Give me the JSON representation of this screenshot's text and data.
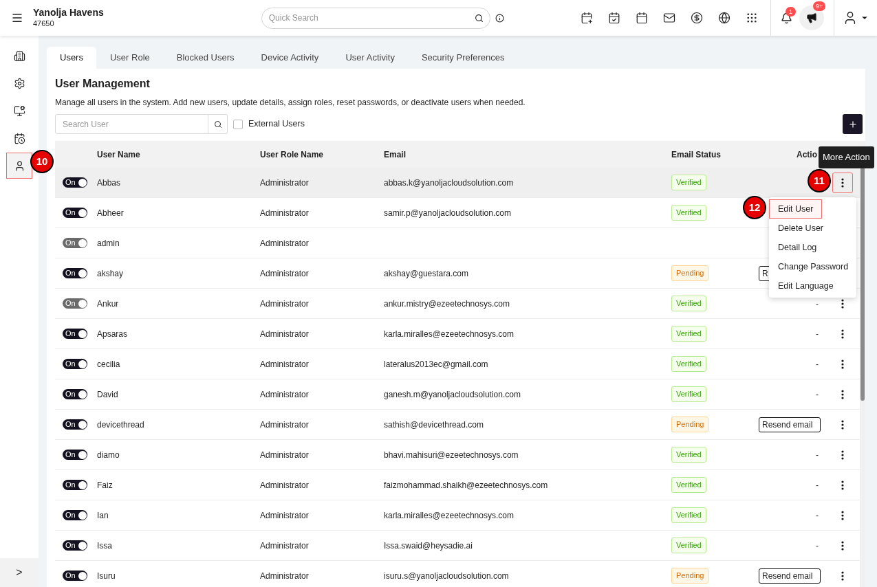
{
  "header": {
    "property_name": "Yanolja Havens",
    "property_code": "47650",
    "search": {
      "placeholder": "Quick Search"
    },
    "notification_count": "1",
    "announcement_count": "9+"
  },
  "sidebar": {
    "items": [
      {
        "selected": false
      },
      {
        "selected": false
      },
      {
        "selected": false
      },
      {
        "selected": false
      },
      {
        "selected": true
      }
    ],
    "expand": ">"
  },
  "tabs": [
    {
      "label": "Users",
      "selected": true
    },
    {
      "label": "User Role",
      "selected": false
    },
    {
      "label": "Blocked Users",
      "selected": false
    },
    {
      "label": "Device Activity",
      "selected": false
    },
    {
      "label": "User Activity",
      "selected": false
    },
    {
      "label": "Security Preferences",
      "selected": false
    }
  ],
  "title": "User Management",
  "description": "Manage all users in the system. Add new users, update details, assign roles, reset passwords, or deactivate users when needed.",
  "search_user": {
    "placeholder": "Search User"
  },
  "external_users": {
    "label": "External Users",
    "checked": false
  },
  "table": {
    "columns": [
      "User Name",
      "User Role Name",
      "Email",
      "Email Status",
      "Actio"
    ],
    "rows": [
      {
        "toggle": "On",
        "disabled": false,
        "name": "Abbas",
        "role": "Administrator",
        "email": "abbas.k@yanoljacloudsolution.com",
        "status": {
          "kind": "verified",
          "label": "Verified"
        },
        "selected": true
      },
      {
        "toggle": "On",
        "disabled": false,
        "name": "Abheer",
        "role": "Administrator",
        "email": "samir.p@yanoljacloudsolution.com",
        "status": {
          "kind": "verified",
          "label": "Verified"
        },
        "selected": false
      },
      {
        "toggle": "On",
        "disabled": true,
        "name": "admin",
        "role": "Administrator",
        "selected": false
      },
      {
        "toggle": "On",
        "disabled": false,
        "name": "akshay",
        "role": "Administrator",
        "email": "akshay@guestara.com",
        "status": {
          "kind": "pending",
          "label": "Pending"
        },
        "action": {
          "kind": "button",
          "label": "R"
        },
        "selected": false
      },
      {
        "toggle": "On",
        "disabled": true,
        "name": "Ankur",
        "role": "Administrator",
        "email": "ankur.mistry@ezeetechnosys.com",
        "status": {
          "kind": "verified",
          "label": "Verified"
        },
        "action": {
          "kind": "text",
          "label": "-"
        },
        "selected": false
      },
      {
        "toggle": "On",
        "disabled": false,
        "name": "Apsaras",
        "role": "Administrator",
        "email": "karla.miralles@ezeetechnosys.com",
        "status": {
          "kind": "verified",
          "label": "Verified"
        },
        "action": {
          "kind": "text",
          "label": "-"
        },
        "selected": false
      },
      {
        "toggle": "On",
        "disabled": false,
        "name": "cecilia",
        "role": "Administrator",
        "email": "lateralus2013ec@gmail.com",
        "status": {
          "kind": "verified",
          "label": "Verified"
        },
        "action": {
          "kind": "text",
          "label": "-"
        },
        "selected": false
      },
      {
        "toggle": "On",
        "disabled": false,
        "name": "David",
        "role": "Administrator",
        "email": "ganesh.m@yanoljacloudsolution.com",
        "status": {
          "kind": "verified",
          "label": "Verified"
        },
        "action": {
          "kind": "text",
          "label": "-"
        },
        "selected": false
      },
      {
        "toggle": "On",
        "disabled": false,
        "name": "devicethread",
        "role": "Administrator",
        "email": "sathish@devicethread.com",
        "status": {
          "kind": "pending",
          "label": "Pending"
        },
        "action": {
          "kind": "button",
          "label": "Resend email"
        },
        "selected": false
      },
      {
        "toggle": "On",
        "disabled": false,
        "name": "diamo",
        "role": "Administrator",
        "email": "bhavi.mahisuri@ezeetechnosys.com",
        "status": {
          "kind": "verified",
          "label": "Verified"
        },
        "action": {
          "kind": "text",
          "label": "-"
        },
        "selected": false
      },
      {
        "toggle": "On",
        "disabled": false,
        "name": "Faiz",
        "role": "Administrator",
        "email": "faizmohammad.shaikh@ezeetechnosys.com",
        "status": {
          "kind": "verified",
          "label": "Verified"
        },
        "action": {
          "kind": "text",
          "label": "-"
        },
        "selected": false
      },
      {
        "toggle": "On",
        "disabled": false,
        "name": "Ian",
        "role": "Administrator",
        "email": "karla.miralles@ezeetechnosys.com",
        "status": {
          "kind": "verified",
          "label": "Verified"
        },
        "action": {
          "kind": "text",
          "label": "-"
        },
        "selected": false
      },
      {
        "toggle": "On",
        "disabled": false,
        "name": "Issa",
        "role": "Administrator",
        "email": "Issa.swaid@heysadie.ai",
        "status": {
          "kind": "verified",
          "label": "Verified"
        },
        "action": {
          "kind": "text",
          "label": "-"
        },
        "selected": false
      },
      {
        "toggle": "On",
        "disabled": false,
        "name": "Isuru",
        "role": "Administrator",
        "email": "isuru.s@yanoljacloudsolution.com",
        "status": {
          "kind": "pending",
          "label": "Pending"
        },
        "action": {
          "kind": "button",
          "label": "Resend email"
        },
        "selected": false
      }
    ]
  },
  "tooltip": "More Action",
  "row_menu": {
    "items": [
      {
        "label": "Edit User",
        "highlighted": true
      },
      {
        "label": "Delete User",
        "highlighted": false
      },
      {
        "label": "Detail Log",
        "highlighted": false
      },
      {
        "label": "Change Password",
        "highlighted": false
      },
      {
        "label": "Edit Language",
        "highlighted": false
      }
    ]
  },
  "step_markers": [
    "10",
    "11",
    "12"
  ]
}
